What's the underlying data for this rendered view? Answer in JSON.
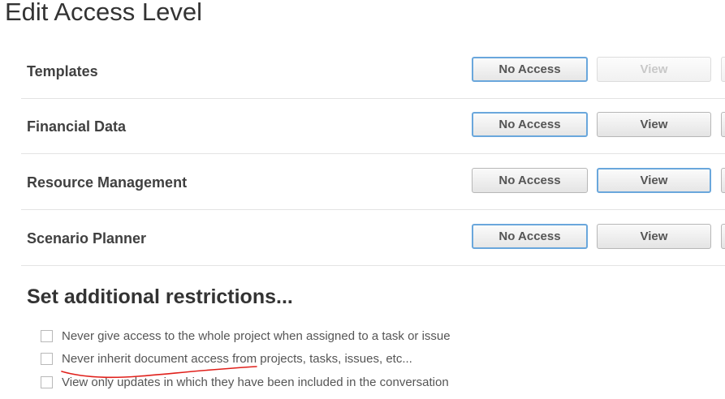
{
  "page_title": "Edit Access Level",
  "permission_rows": [
    {
      "label": "Templates",
      "no_access_label": "No Access",
      "view_label": "View",
      "selected": "no_access",
      "view_disabled": true
    },
    {
      "label": "Financial Data",
      "no_access_label": "No Access",
      "view_label": "View",
      "selected": "no_access",
      "view_disabled": false
    },
    {
      "label": "Resource Management",
      "no_access_label": "No Access",
      "view_label": "View",
      "selected": "view",
      "view_disabled": false
    },
    {
      "label": "Scenario Planner",
      "no_access_label": "No Access",
      "view_label": "View",
      "selected": "no_access",
      "view_disabled": false
    }
  ],
  "restrictions": {
    "title": "Set additional restrictions...",
    "options": [
      {
        "label": "Never give access to the whole project when assigned to a task or issue",
        "checked": false
      },
      {
        "label": "Never inherit document access from projects, tasks, issues, etc...",
        "checked": false
      },
      {
        "label": "View only updates in which they have been included in the conversation",
        "checked": false
      }
    ]
  },
  "colors": {
    "selected_border": "#6aa7dc",
    "annotation_underline": "#e0201b"
  }
}
